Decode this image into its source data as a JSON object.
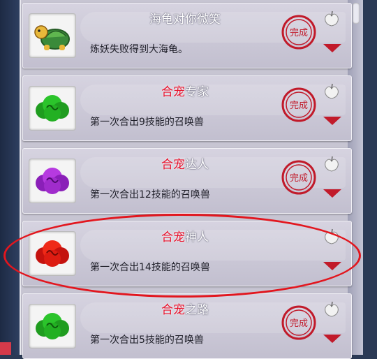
{
  "achievements": [
    {
      "title_red": "",
      "title_white": "海龟对你微笑",
      "description": "炼妖失败得到大海龟。",
      "icon": "sea-turtle-icon"
    },
    {
      "title_red": "合宠",
      "title_white": "专家",
      "description": "第一次合出9技能的召唤兽",
      "icon": "green-cloud-icon"
    },
    {
      "title_red": "合宠",
      "title_white": "达人",
      "description": "第一次合出12技能的召唤兽",
      "icon": "purple-cloud-icon"
    },
    {
      "title_red": "合宠",
      "title_white": "神人",
      "description": "第一次合出14技能的召唤兽",
      "icon": "red-cloud-icon"
    },
    {
      "title_red": "合宠",
      "title_white": "之路",
      "description": "第一次合出5技能的召唤兽",
      "icon": "green-cloud-icon"
    }
  ],
  "seal_text": "完成",
  "colors": {
    "accent_red": "#e8102a",
    "seal_red": "#c11a2a",
    "highlight_ellipse": "#e2161e"
  }
}
